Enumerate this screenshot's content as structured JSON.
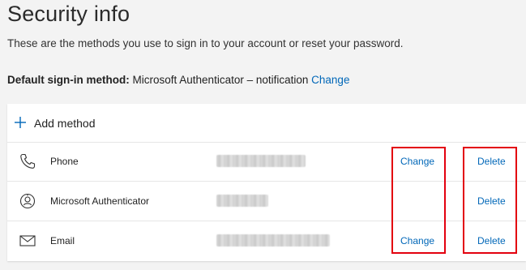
{
  "page": {
    "title": "Security info",
    "subtitle": "These are the methods you use to sign in to your account or reset your password."
  },
  "default_method": {
    "label": "Default sign-in method:",
    "value": "Microsoft Authenticator – notification",
    "change_label": "Change"
  },
  "methods_card": {
    "add_label": "Add method",
    "add_icon": "plus-icon",
    "rows": [
      {
        "name": "Phone",
        "icon": "phone-icon",
        "value_redacted": true,
        "change_label": "Change",
        "delete_label": "Delete"
      },
      {
        "name": "Microsoft Authenticator",
        "icon": "authenticator-icon",
        "value_redacted": true,
        "change_label": "",
        "delete_label": "Delete"
      },
      {
        "name": "Email",
        "icon": "email-icon",
        "value_redacted": true,
        "change_label": "Change",
        "delete_label": "Delete"
      }
    ]
  },
  "colors": {
    "link": "#0067b8",
    "highlight": "#e3000f",
    "background": "#f3f3f3"
  }
}
